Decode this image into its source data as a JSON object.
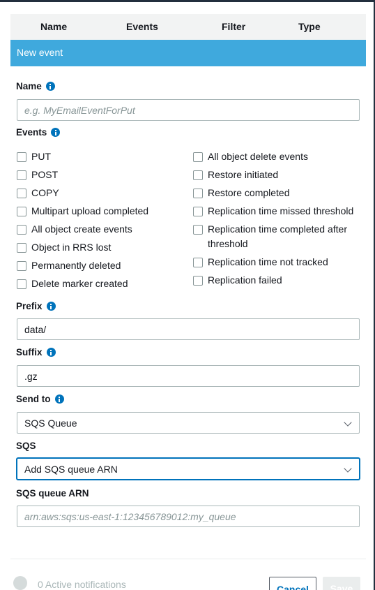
{
  "table": {
    "columns": [
      "Name",
      "Events",
      "Filter",
      "Type"
    ]
  },
  "form": {
    "header": "New event",
    "name": {
      "label": "Name",
      "placeholder": "e.g. MyEmailEventForPut",
      "value": ""
    },
    "events": {
      "label": "Events",
      "left": [
        "PUT",
        "POST",
        "COPY",
        "Multipart upload completed",
        "All object create events",
        "Object in RRS lost",
        "Permanently deleted",
        "Delete marker created"
      ],
      "right": [
        "All object delete events",
        "Restore initiated",
        "Restore completed",
        "Replication time missed threshold",
        "Replication time completed after threshold",
        "Replication time not tracked",
        "Replication failed"
      ]
    },
    "prefix": {
      "label": "Prefix",
      "value": "data/"
    },
    "suffix": {
      "label": "Suffix",
      "value": ".gz"
    },
    "send_to": {
      "label": "Send to",
      "value": "SQS Queue"
    },
    "sqs": {
      "label": "SQS",
      "value": "Add SQS queue ARN"
    },
    "sqs_arn": {
      "label": "SQS queue ARN",
      "placeholder": "arn:aws:sqs:us-east-1:123456789012:my_queue",
      "value": ""
    }
  },
  "footer": {
    "active_notifications": "0 Active notifications",
    "cancel_label": "Cancel",
    "save_label": "Save"
  },
  "colors": {
    "header_blue": "#3fa9dd",
    "link_blue": "#0073bb"
  }
}
